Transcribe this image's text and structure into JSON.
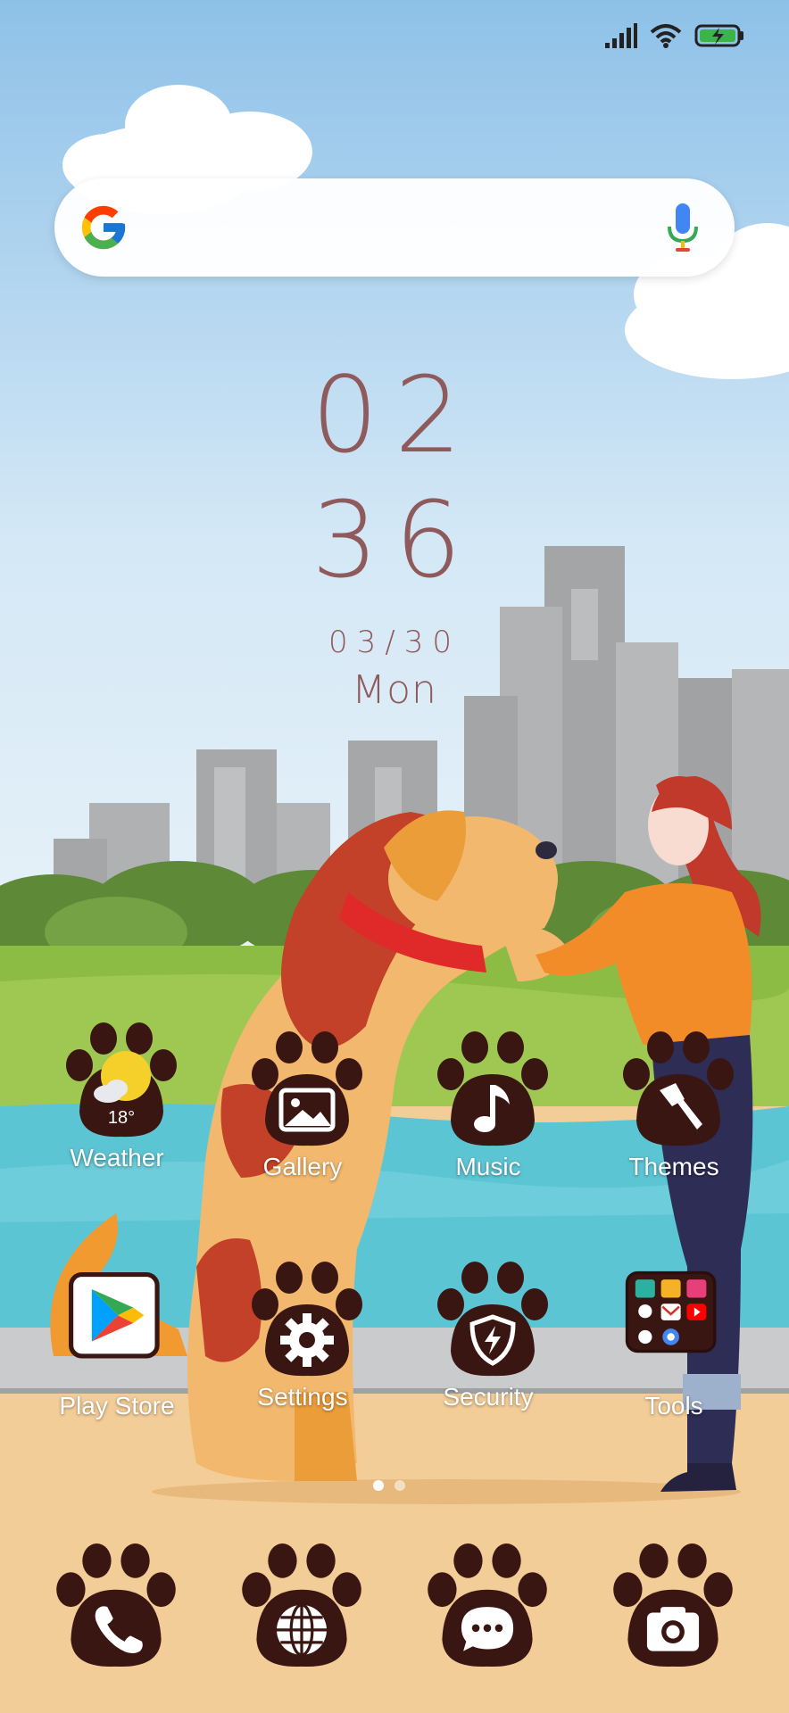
{
  "status_bar": {
    "signal_icon": "signal-bars-icon",
    "wifi_icon": "wifi-icon",
    "battery_icon": "battery-charging-icon",
    "battery_color": "#3bb54a"
  },
  "search": {
    "logo_icon": "google-g-icon",
    "mic_icon": "microphone-icon"
  },
  "clock": {
    "hour": "02",
    "minute": "36",
    "date": "03/30",
    "day": "Mon",
    "color": "#8f5a5c"
  },
  "apps_row1": [
    {
      "label": "Weather",
      "icon": "weather-sun-cloud-icon",
      "temp": "18°"
    },
    {
      "label": "Gallery",
      "icon": "gallery-image-icon"
    },
    {
      "label": "Music",
      "icon": "music-note-icon"
    },
    {
      "label": "Themes",
      "icon": "paintbrush-icon"
    }
  ],
  "apps_row2": [
    {
      "label": "Play Store",
      "icon": "play-store-icon"
    },
    {
      "label": "Settings",
      "icon": "gear-icon"
    },
    {
      "label": "Security",
      "icon": "shield-bolt-icon"
    },
    {
      "label": "Tools",
      "icon": "folder-icon"
    }
  ],
  "dock": [
    {
      "icon": "phone-icon"
    },
    {
      "icon": "globe-icon"
    },
    {
      "icon": "chat-bubble-icon"
    },
    {
      "icon": "camera-icon"
    }
  ],
  "page_indicator": {
    "pages": 2,
    "current": 1
  },
  "theme": {
    "paw_color": "#3a1612",
    "sky_top": "#8ec1e8",
    "sand": "#f3cd98"
  }
}
